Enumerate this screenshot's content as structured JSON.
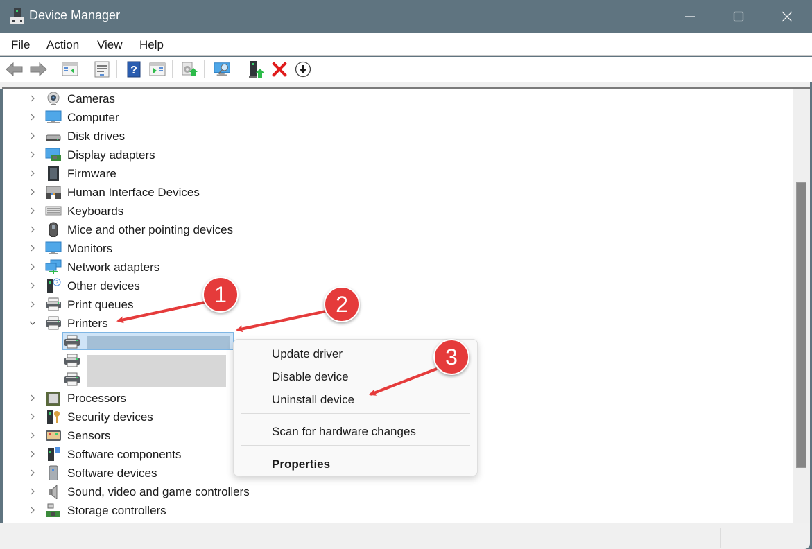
{
  "window": {
    "title": "Device Manager",
    "controls": [
      "minimize",
      "maximize",
      "close"
    ]
  },
  "menubar": {
    "items": [
      {
        "label": "File"
      },
      {
        "label": "Action"
      },
      {
        "label": "View"
      },
      {
        "label": "Help"
      }
    ]
  },
  "toolbar": {
    "buttons": [
      {
        "name": "back",
        "icon": "arrow-left-icon"
      },
      {
        "name": "forward",
        "icon": "arrow-right-icon"
      },
      {
        "name": "show-hide-console-tree",
        "icon": "console-tree-icon"
      },
      {
        "name": "properties",
        "icon": "properties-icon"
      },
      {
        "name": "help",
        "icon": "help-icon"
      },
      {
        "name": "show-action-pane",
        "icon": "action-pane-icon"
      },
      {
        "name": "update-driver",
        "icon": "update-driver-icon"
      },
      {
        "name": "scan-hardware",
        "icon": "scan-monitor-icon"
      },
      {
        "name": "enable-device",
        "icon": "enable-device-icon"
      },
      {
        "name": "uninstall-device",
        "icon": "red-x-icon",
        "color": "#e01b1b"
      },
      {
        "name": "download",
        "icon": "down-arrow-circle-icon"
      }
    ]
  },
  "tree": {
    "categories": [
      {
        "label": "Cameras",
        "icon": "camera-icon",
        "expanded": false
      },
      {
        "label": "Computer",
        "icon": "computer-icon",
        "expanded": false
      },
      {
        "label": "Disk drives",
        "icon": "disk-drive-icon",
        "expanded": false
      },
      {
        "label": "Display adapters",
        "icon": "display-adapter-icon",
        "expanded": false
      },
      {
        "label": "Firmware",
        "icon": "firmware-chip-icon",
        "expanded": false
      },
      {
        "label": "Human Interface Devices",
        "icon": "hid-icon",
        "expanded": false
      },
      {
        "label": "Keyboards",
        "icon": "keyboard-icon",
        "expanded": false
      },
      {
        "label": "Mice and other pointing devices",
        "icon": "mouse-icon",
        "expanded": false
      },
      {
        "label": "Monitors",
        "icon": "monitor-icon",
        "expanded": false
      },
      {
        "label": "Network adapters",
        "icon": "network-icon",
        "expanded": false
      },
      {
        "label": "Other devices",
        "icon": "unknown-device-icon",
        "expanded": false
      },
      {
        "label": "Print queues",
        "icon": "printer-icon",
        "expanded": false
      },
      {
        "label": "Printers",
        "icon": "printer-icon",
        "expanded": true,
        "children": [
          {
            "label": "",
            "redacted": true,
            "selected": true
          },
          {
            "label": "",
            "redacted": true,
            "selected": false
          },
          {
            "label": "",
            "redacted": true,
            "selected": false
          }
        ]
      },
      {
        "label": "Processors",
        "icon": "processor-icon",
        "expanded": false
      },
      {
        "label": "Security devices",
        "icon": "security-key-icon",
        "expanded": false
      },
      {
        "label": "Sensors",
        "icon": "sensor-icon",
        "expanded": false
      },
      {
        "label": "Software components",
        "icon": "software-component-icon",
        "expanded": false
      },
      {
        "label": "Software devices",
        "icon": "software-device-icon",
        "expanded": false
      },
      {
        "label": "Sound, video and game controllers",
        "icon": "speaker-icon",
        "expanded": false
      },
      {
        "label": "Storage controllers",
        "icon": "storage-controller-icon",
        "expanded": false
      }
    ]
  },
  "context_menu": {
    "items": [
      {
        "label": "Update driver",
        "bold": false
      },
      {
        "label": "Disable device",
        "bold": false
      },
      {
        "label": "Uninstall device",
        "bold": false
      },
      {
        "separator": true
      },
      {
        "label": "Scan for hardware changes",
        "bold": false
      },
      {
        "separator": true
      },
      {
        "label": "Properties",
        "bold": true
      }
    ]
  },
  "annotations": {
    "badges": [
      "1",
      "2",
      "3"
    ],
    "color": "#e53b3b"
  }
}
